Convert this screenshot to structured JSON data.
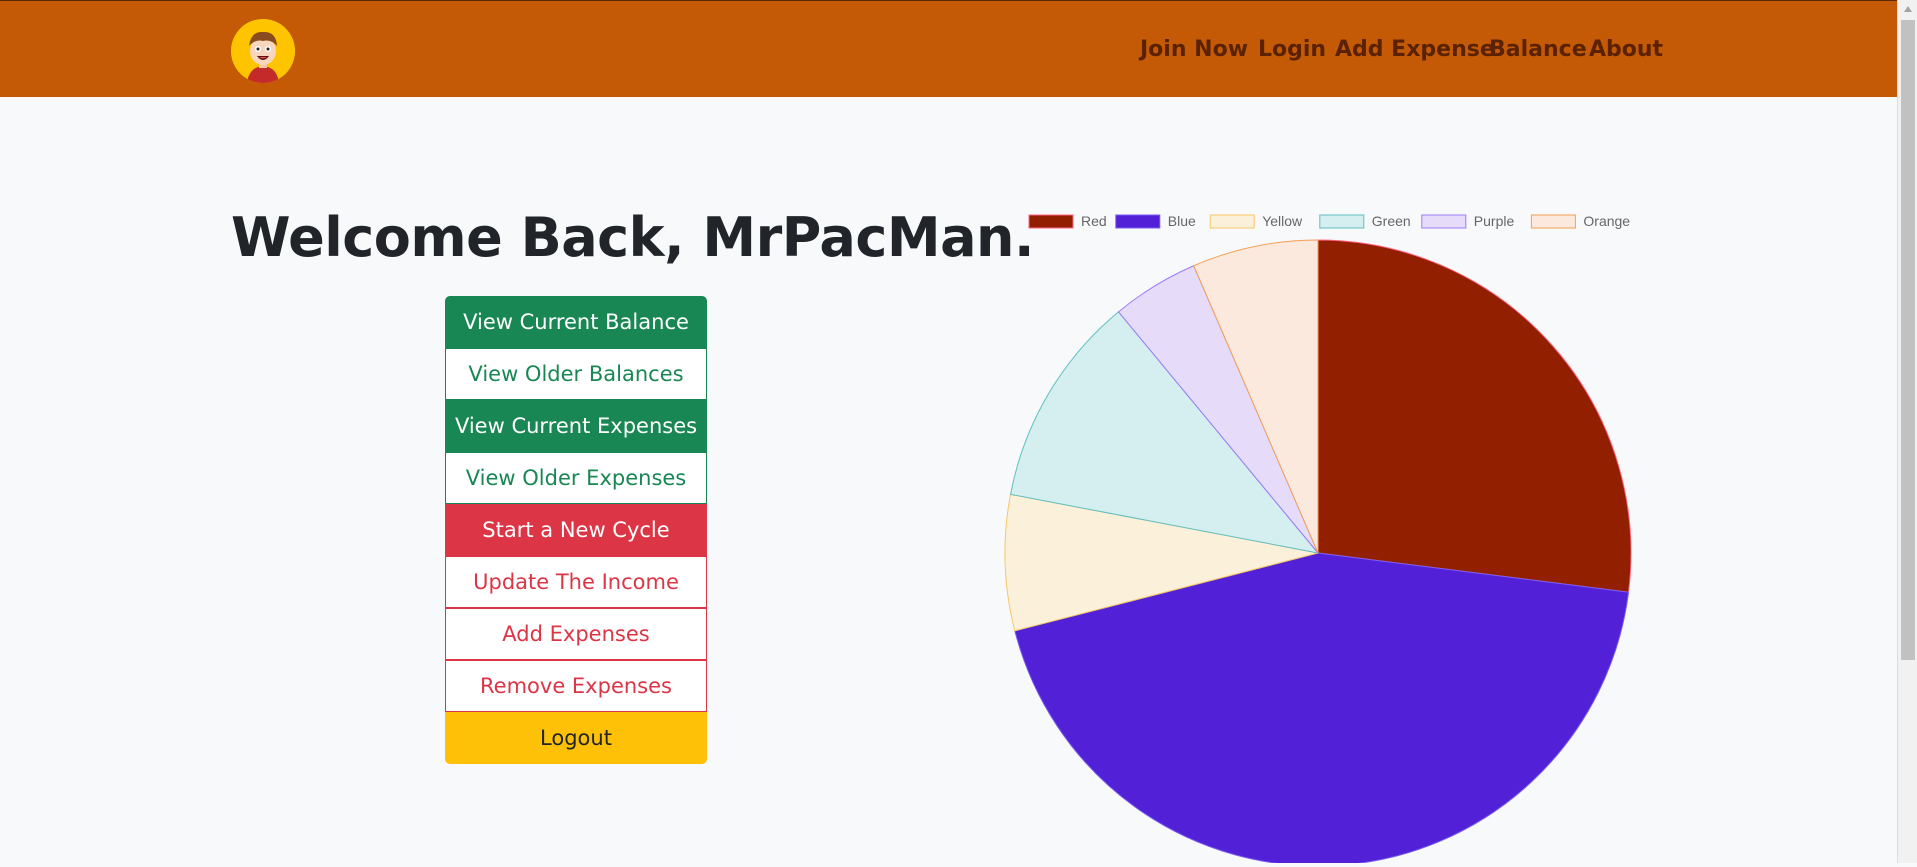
{
  "header": {
    "logo_icon": "cartoon-avatar-icon",
    "nav": [
      {
        "label": "Join Now"
      },
      {
        "label": "Login"
      },
      {
        "label": "Add Expense"
      },
      {
        "label": "Balance"
      },
      {
        "label": "About"
      }
    ]
  },
  "main": {
    "welcome": "Welcome Back, MrPacMan.",
    "buttons": [
      {
        "label": "View Current Balance"
      },
      {
        "label": "View Older Balances"
      },
      {
        "label": "View Current Expenses"
      },
      {
        "label": "View Older Expenses"
      },
      {
        "label": "Start a New Cycle"
      },
      {
        "label": "Update The Income"
      },
      {
        "label": "Add Expenses"
      },
      {
        "label": "Remove Expenses"
      },
      {
        "label": "Logout"
      }
    ]
  },
  "chart_data": {
    "type": "pie",
    "categories": [
      "Red",
      "Blue",
      "Yellow",
      "Green",
      "Purple",
      "Orange"
    ],
    "values": [
      27,
      44,
      7,
      11,
      4.5,
      6.5
    ],
    "colors": [
      "#922000",
      "#5220d6",
      "#fbf1da",
      "#d5eef0",
      "#e6dcfa",
      "#fae9dc"
    ],
    "borders": [
      "#ff6384",
      "#7a5cf0",
      "#f5c76a",
      "#5fbfc0",
      "#9b7cf5",
      "#f59f52"
    ],
    "legend_position": "top"
  }
}
